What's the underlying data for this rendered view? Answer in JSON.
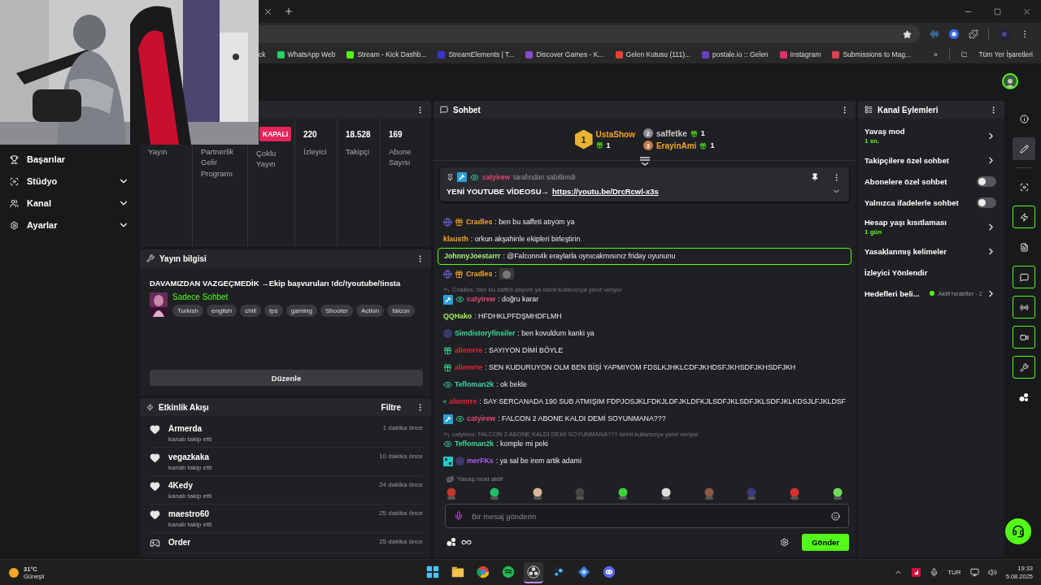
{
  "browser": {
    "bookmarks": [
      {
        "label": "ck"
      },
      {
        "label": "WhatsApp Web",
        "color": "#25d366"
      },
      {
        "label": "Stream - Kick Dashb...",
        "color": "#53fc18"
      },
      {
        "label": "StreamElements | T...",
        "color": "#3b34d6"
      },
      {
        "label": "Discover Games - K...",
        "color": "#8a4ad0"
      },
      {
        "label": "Gelen Kutusu (111)...",
        "color": "#ea4335"
      },
      {
        "label": "postale.io :: Gelen",
        "color": "#6a3fc8"
      },
      {
        "label": "Instagram",
        "color": "#e1306c"
      },
      {
        "label": "Submissions to Mag...",
        "color": "#e04050"
      }
    ],
    "overflow": "»",
    "all_bookmarks": "Tüm Yer İşaretleri"
  },
  "sidebar": {
    "items": [
      {
        "label": "Başarılar"
      },
      {
        "label": "Stüdyo",
        "expanded": false
      },
      {
        "label": "Kanal",
        "expanded": false
      },
      {
        "label": "Ayarlar",
        "expanded": false
      }
    ]
  },
  "stats": {
    "columns": [
      {
        "label": "Yayın"
      },
      {
        "label": "Partnerlik Gelir Programı"
      },
      {
        "badge": "KAPALI",
        "label": "Çoklu Yayın"
      },
      {
        "value": "220",
        "label": "İzleyici"
      },
      {
        "value": "18.528",
        "label": "Takipçi"
      },
      {
        "value": "169",
        "label": "Abone Sayısı"
      }
    ]
  },
  "stream_info": {
    "title": "Yayın bilgisi",
    "stream_title": "DAVAMIZDAN VAZGEÇMEDİK →Ekip başvuruları !dc/!youtube/!insta",
    "category": "Sadece Sohbet",
    "tags": [
      "Turkish",
      "english",
      "chill",
      "fps",
      "gaming",
      "Shooter",
      "Action",
      "falcon"
    ],
    "edit_button": "Düzenle"
  },
  "activity": {
    "title": "Etkinlik Akışı",
    "filter": "Filtre",
    "events": [
      {
        "kind": "follow",
        "name": "Armerda",
        "action": "kanalı takip etti",
        "time": "1 dakika önce"
      },
      {
        "kind": "follow",
        "name": "vegazkaka",
        "action": "kanalı takip etti",
        "time": "10 dakika önce"
      },
      {
        "kind": "follow",
        "name": "4Kedy",
        "action": "kanalı takip etti",
        "time": "24 dakika önce"
      },
      {
        "kind": "follow",
        "name": "maestro60",
        "action": "kanalı takip etti",
        "time": "25 dakika önce"
      },
      {
        "kind": "other",
        "name": "Order",
        "time": "25 dakika önce"
      }
    ]
  },
  "chat": {
    "title": "Sohbet",
    "leaders": [
      {
        "rank": "1",
        "name": "UstaShow",
        "count": "1",
        "color": "#f5a623"
      },
      {
        "rank": "2",
        "name": "saffetke",
        "count": "1",
        "color": "#c8c8c8"
      },
      {
        "rank": "3",
        "name": "ErayinAmi",
        "count": "1",
        "color": "#f5a623"
      }
    ],
    "pinned": {
      "author": {
        "name": "catyirew",
        "color": "#e8457a"
      },
      "note": "tarafından sabitlendi",
      "text": "YENİ YOUTUBE VİDEOSU→",
      "link": "https://youtu.be/DrcRcwl-x3s"
    },
    "messages": [
      {
        "kind": "text",
        "badges": [
          {
            "kind": "globe"
          },
          {
            "kind": "gift"
          }
        ],
        "name": "Cradles",
        "color": "#f5a623",
        "text": ": ben bu saffeti atıyom ya",
        "highlighted": false
      },
      {
        "kind": "text",
        "name": "klausth",
        "color": "#f5a623",
        "text": ": orkun akşahinle ekipleri birleştirin",
        "highlighted": false
      },
      {
        "kind": "text",
        "name": "JohnnyJoestarrr",
        "color": "#a7f07a",
        "text": ": @Falconn4k eraylarla oynıcakmısınız friday oyununu",
        "highlighted": true
      },
      {
        "kind": "emote",
        "badges": [
          {
            "kind": "globe"
          },
          {
            "kind": "gift"
          }
        ],
        "name": "Cradles",
        "color": "#f5a623",
        "text": ":",
        "highlighted": false
      },
      {
        "kind": "text",
        "badges": [
          {
            "kind": "mod"
          },
          {
            "kind": "eye"
          }
        ],
        "name": "catyirew",
        "color": "#e8457a",
        "text": ": doğru karar",
        "reply": "Cradles: ben bu saffeti atıyom ya isimli kullanıcıya yanıt veriyor",
        "highlighted": false
      },
      {
        "kind": "text",
        "name": "QQHako",
        "color": "#a6f05a",
        "text": ": HFDHKLPFDŞMHDFLMH",
        "highlighted": false
      },
      {
        "kind": "text",
        "badges": [
          {
            "kind": "avatar"
          }
        ],
        "name": "Simdistoryfinsiler",
        "color": "#3dd6a0",
        "text": ": ben kovuldum kanki ya",
        "highlighted": false
      },
      {
        "kind": "text",
        "badges": [
          {
            "kind": "sub"
          }
        ],
        "name": "aliemrre",
        "color": "#e8243c",
        "text": ": SAYIYON DİMİ BÖYLE",
        "highlighted": false
      },
      {
        "kind": "text",
        "badges": [
          {
            "kind": "sub"
          }
        ],
        "name": "aliemrre",
        "color": "#e8243c",
        "text": ": SEN KUDURUYON OLM BEN BİŞİ YAPMIYOM FDSLKJHKLCDFJKHDSFJKHSDFJKHSDFJKH",
        "highlighted": false
      },
      {
        "kind": "text",
        "badges": [
          {
            "kind": "eye"
          }
        ],
        "name": "Tefloman2k",
        "color": "#3dd6a0",
        "text": ": ok bekle",
        "highlighted": false
      },
      {
        "kind": "text",
        "badges": [
          {
            "kind": "sub"
          }
        ],
        "name": "aliemrre",
        "color": "#e8243c",
        "text": ": SAY SERCANADA 190 SUB ATMIŞIM FDPJOSJKLFDKJLDFJKLDFKJLSDFJKLSDFJKLSDFJKLKDSJLFJKLDSF",
        "highlighted": false
      },
      {
        "kind": "text",
        "badges": [
          {
            "kind": "mod"
          },
          {
            "kind": "eye"
          }
        ],
        "name": "catyirew",
        "color": "#e8457a",
        "text": ": FALCON 2 ABONE KALDI DEMİ SOYUNMANA???",
        "highlighted": false
      },
      {
        "kind": "text",
        "badges": [
          {
            "kind": "eye"
          }
        ],
        "name": "Tefloman2k",
        "color": "#3dd6a0",
        "text": ": komple mi peki",
        "reply": "catyirew: FALCON 2 ABONE KALDI DEMİ SOYUNMANA??? isimli kullanıcıya yanıt veriyor",
        "highlighted": false
      },
      {
        "kind": "text",
        "badges": [
          {
            "kind": "og"
          },
          {
            "kind": "avatar"
          }
        ],
        "name": "merFKs",
        "color": "#b05cf0",
        "text": ": ya sal be irem artik adami",
        "highlighted": false
      }
    ],
    "slow_mode": "Yavaş mod aktif",
    "emotes": [
      {
        "color": "#c0392b"
      },
      {
        "color": "#1fbf6a"
      },
      {
        "color": "#d8b89a"
      },
      {
        "color": "#444444"
      },
      {
        "color": "#3fd23f"
      },
      {
        "color": "#dddddd"
      },
      {
        "color": "#8a5a44"
      },
      {
        "color": "#3b3b7a"
      },
      {
        "color": "#d83030"
      },
      {
        "color": "#6fdc5a"
      }
    ],
    "input": {
      "placeholder": "Bir mesaj gönderin"
    },
    "send_button": "Gönder"
  },
  "channel_actions": {
    "title": "Kanal Eylemleri",
    "items": [
      {
        "kind": "link",
        "label": "Yavaş mod",
        "sub": "1 sn."
      },
      {
        "kind": "link",
        "label": "Takipçilere özel sohbet"
      },
      {
        "kind": "toggle",
        "label": "Abonelere özel sohbet",
        "on": false
      },
      {
        "kind": "toggle",
        "label": "Yalnızca ifadelerle sohbet",
        "on": false
      },
      {
        "kind": "link",
        "label": "Hesap yaşı kısıtlaması",
        "sub": "1 gün"
      },
      {
        "kind": "link",
        "label": "Yasaklanmış kelimeler"
      },
      {
        "kind": "plain",
        "label": "İzleyici Yönlendir"
      },
      {
        "kind": "goal",
        "label": "Hedefleri beli...",
        "status": "Aktif hedefler - 2",
        "color": "#53fc18"
      }
    ]
  },
  "rail": {
    "items": [
      {
        "selected": false,
        "outlined": false
      },
      {
        "selected": true,
        "outlined": false
      },
      {
        "selected": false,
        "outlined": false
      },
      {
        "selected": false,
        "outlined": true
      },
      {
        "selected": false,
        "outlined": false
      },
      {
        "selected": false,
        "outlined": true
      },
      {
        "selected": false,
        "outlined": true
      },
      {
        "selected": false,
        "outlined": true
      },
      {
        "selected": false,
        "outlined": true
      },
      {
        "selected": false,
        "outlined": false
      }
    ]
  },
  "taskbar": {
    "weather": {
      "temp": "31°C",
      "text": "Güneşli"
    },
    "apps": [
      {
        "selected": false
      },
      {
        "selected": false
      },
      {
        "selected": false
      },
      {
        "selected": false
      },
      {
        "selected": true
      },
      {
        "selected": false
      },
      {
        "selected": false
      },
      {
        "selected": false
      }
    ],
    "language": "TUR",
    "time": "19:33",
    "date": "5.08.2025"
  }
}
